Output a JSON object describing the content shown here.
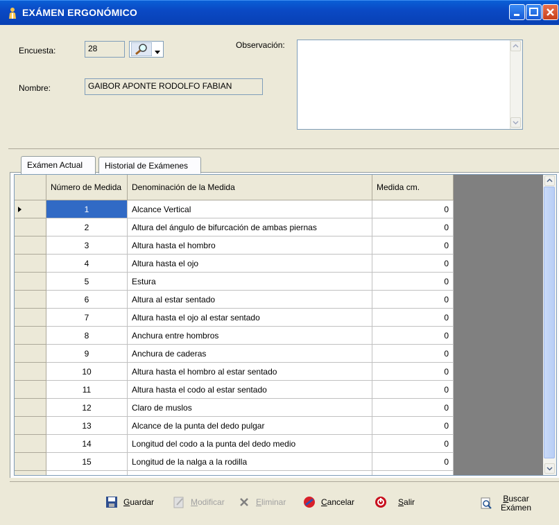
{
  "window": {
    "title": "EXÁMEN ERGONÓMICO"
  },
  "form": {
    "encuesta_label": "Encuesta:",
    "encuesta_value": "28",
    "nombre_label": "Nombre:",
    "nombre_value": "GAIBOR  APONTE RODOLFO FABIAN",
    "observacion_label": "Observación:",
    "observacion_value": ""
  },
  "tabs": [
    {
      "label": "Exámen Actual"
    },
    {
      "label": "Historial de Exámenes"
    }
  ],
  "grid": {
    "headers": {
      "num": "Número de Medida",
      "denom": "Denominación de la Medida",
      "medida": "Medida cm."
    },
    "rows": [
      {
        "num": "1",
        "denom": "Alcance Vertical",
        "medida": "0"
      },
      {
        "num": "2",
        "denom": "Altura del ángulo de bifurcación de ambas piernas",
        "medida": "0"
      },
      {
        "num": "3",
        "denom": "Altura hasta el hombro",
        "medida": "0"
      },
      {
        "num": "4",
        "denom": "Altura hasta el ojo",
        "medida": "0"
      },
      {
        "num": "5",
        "denom": "Estura",
        "medida": "0"
      },
      {
        "num": "6",
        "denom": "Altura al estar sentado",
        "medida": "0"
      },
      {
        "num": "7",
        "denom": "Altura hasta el ojo al estar sentado",
        "medida": "0"
      },
      {
        "num": "8",
        "denom": "Anchura entre hombros",
        "medida": "0"
      },
      {
        "num": "9",
        "denom": "Anchura de caderas",
        "medida": "0"
      },
      {
        "num": "10",
        "denom": "Altura hasta el hombro al estar sentado",
        "medida": "0"
      },
      {
        "num": "11",
        "denom": "Altura hasta el codo al estar sentado",
        "medida": "0"
      },
      {
        "num": "12",
        "denom": "Claro de muslos",
        "medida": "0"
      },
      {
        "num": "13",
        "denom": "Alcance de la punta del dedo pulgar",
        "medida": "0"
      },
      {
        "num": "14",
        "denom": "Longitud del codo a la punta del dedo medio",
        "medida": "0"
      },
      {
        "num": "15",
        "denom": "Longitud de la nalga a la rodilla",
        "medida": "0"
      }
    ]
  },
  "toolbar": {
    "guardar": {
      "first": "G",
      "rest": "uardar"
    },
    "modificar": {
      "first": "M",
      "rest": "odificar"
    },
    "eliminar": {
      "first": "E",
      "rest": "liminar"
    },
    "cancelar": {
      "first": "C",
      "rest": "ancelar"
    },
    "salir": {
      "first": "S",
      "rest": "alir"
    },
    "buscar": {
      "first": "B",
      "rest": "uscar",
      "line2": "Exámen"
    }
  },
  "colors": {
    "titlebar": "#0a49c4",
    "selection": "#316ac5",
    "panel": "#ece9d8"
  }
}
